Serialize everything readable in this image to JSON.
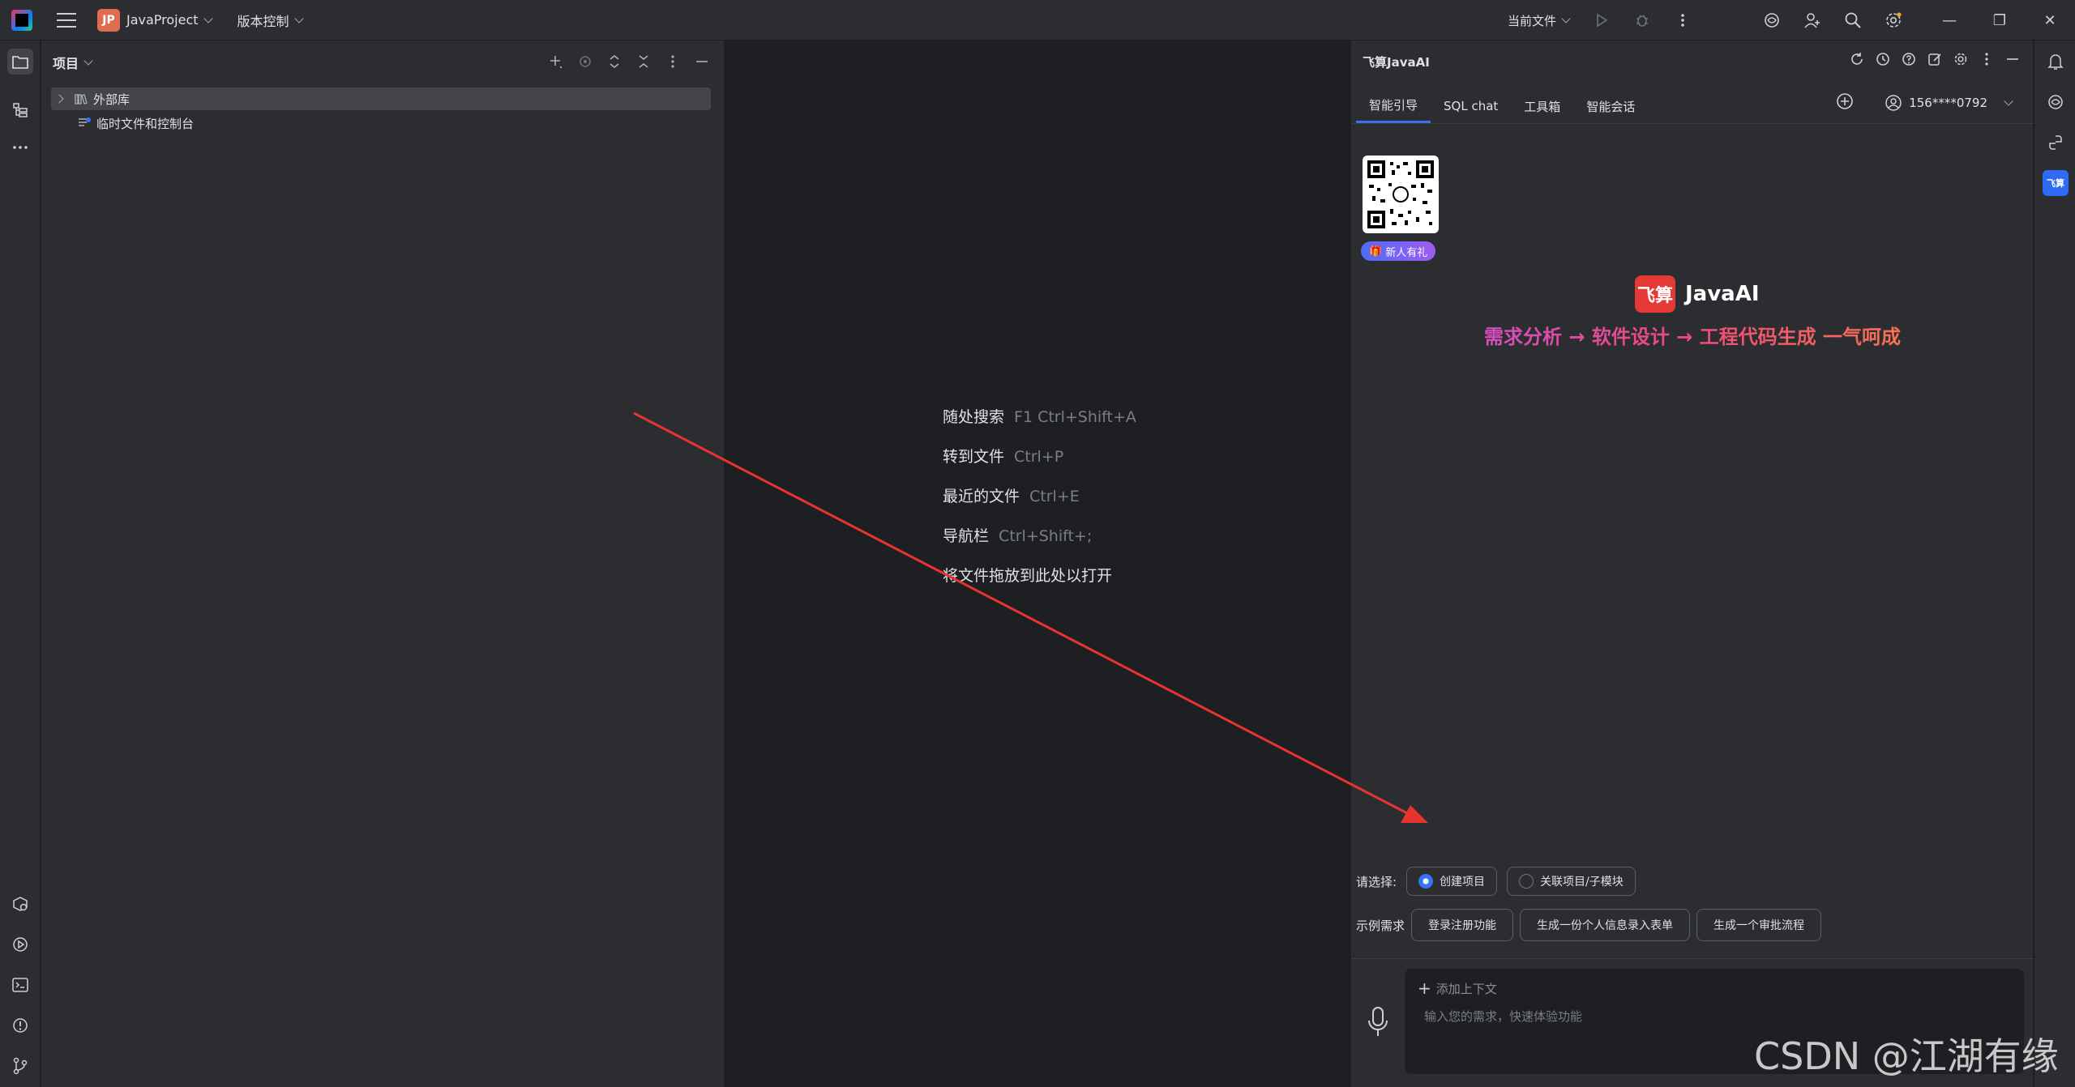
{
  "titlebar": {
    "project_badge": "JP",
    "project_name": "JavaProject",
    "vcs_label": "版本控制",
    "current_file": "当前文件"
  },
  "project_panel": {
    "title": "项目",
    "tree": [
      {
        "label": "外部库",
        "selected": true
      },
      {
        "label": "临时文件和控制台",
        "selected": false
      }
    ]
  },
  "editor": {
    "hints": [
      {
        "label": "随处搜索",
        "key": "F1 Ctrl+Shift+A"
      },
      {
        "label": "转到文件",
        "key": "Ctrl+P"
      },
      {
        "label": "最近的文件",
        "key": "Ctrl+E"
      },
      {
        "label": "导航栏",
        "key": "Ctrl+Shift+;"
      },
      {
        "label": "将文件拖放到此处以打开",
        "key": ""
      }
    ]
  },
  "ai_panel": {
    "title": "飞算JavaAI",
    "tabs": [
      "智能引导",
      "SQL chat",
      "工具箱",
      "智能会话"
    ],
    "account": "156****0792",
    "gift_label": "新人有礼",
    "brand_logo": "飞算",
    "brand_name": "JavaAI",
    "slogan": "需求分析 → 软件设计 → 工程代码生成 一气呵成",
    "select_label": "请选择:",
    "options": [
      {
        "label": "创建项目",
        "checked": true
      },
      {
        "label": "关联项目/子模块",
        "checked": false
      }
    ],
    "examples_label": "示例需求",
    "examples": [
      "登录注册功能",
      "生成一份个人信息录入表单",
      "生成一个审批流程"
    ],
    "add_context": "添加上下文",
    "input_placeholder": "输入您的需求，快速体验功能"
  },
  "right_strip": {
    "feisuan_label": "飞算"
  },
  "watermark": "CSDN @江湖有缘",
  "colors": {
    "accent": "#3574f0",
    "arrow": "#e8342e",
    "brand_red": "#e53935"
  }
}
